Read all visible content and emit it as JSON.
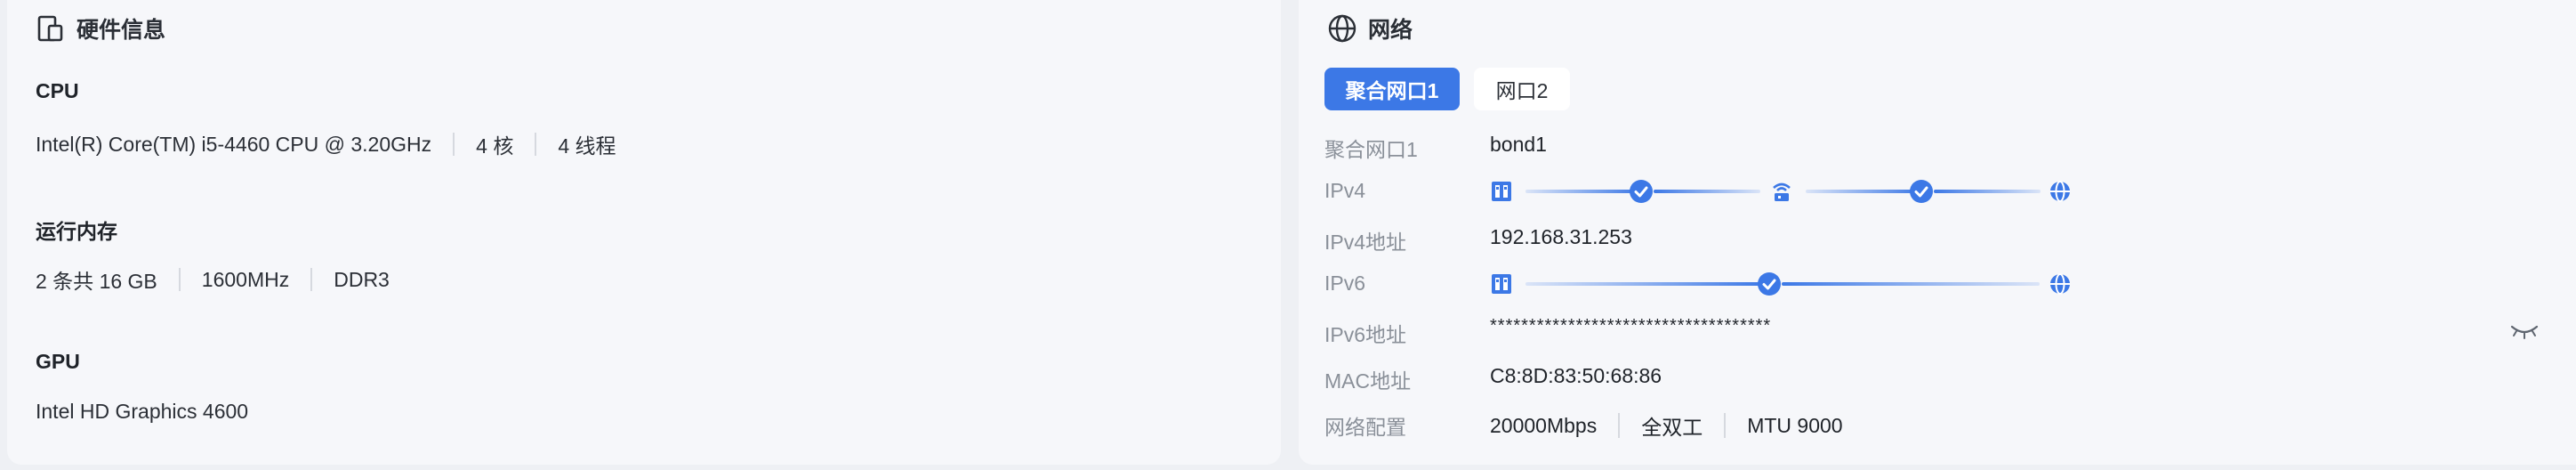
{
  "hardware": {
    "title": "硬件信息",
    "cpu": {
      "heading": "CPU",
      "model": "Intel(R) Core(TM) i5-4460 CPU @ 3.20GHz",
      "cores": "4 核",
      "threads": "4 线程"
    },
    "memory": {
      "heading": "运行内存",
      "capacity": "2 条共 16 GB",
      "speed": "1600MHz",
      "type": "DDR3"
    },
    "gpu": {
      "heading": "GPU",
      "model": "Intel HD Graphics 4600"
    }
  },
  "network": {
    "title": "网络",
    "tabs": [
      {
        "label": "聚合网口1",
        "active": true
      },
      {
        "label": "网口2",
        "active": false
      }
    ],
    "rows": {
      "aggregate": {
        "label": "聚合网口1",
        "value": "bond1"
      },
      "ipv4": {
        "label": "IPv4"
      },
      "ipv4_addr": {
        "label": "IPv4地址",
        "value": "192.168.31.253"
      },
      "ipv6": {
        "label": "IPv6"
      },
      "ipv6_addr": {
        "label": "IPv6地址",
        "value": "************************************"
      },
      "mac": {
        "label": "MAC地址",
        "value": "C8:8D:83:50:68:86"
      },
      "config": {
        "label": "网络配置",
        "speed": "20000Mbps",
        "duplex": "全双工",
        "mtu": "MTU 9000"
      }
    },
    "icons": {
      "device": "device-icon",
      "router": "router-icon",
      "internet": "globe-icon",
      "status": "check-circle-icon",
      "reveal": "eye-closed-icon"
    },
    "colors": {
      "accent": "#3c78e6",
      "label": "#8a9099"
    }
  }
}
